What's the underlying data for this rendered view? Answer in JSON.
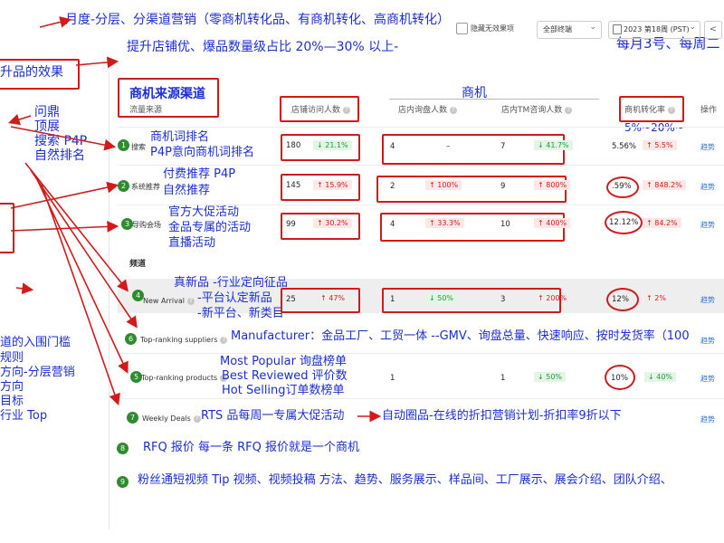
{
  "notes": {
    "top1": "月度-分层、分渠道营销（零商机转化品、有商机转化、高商机转化）",
    "top2": "提升店铺优、爆品数量级占比 20%—30% 以上-",
    "top_right": "每月3号、每周二",
    "left_effect": "升品的效果",
    "left_list": [
      "问鼎",
      "顶展",
      "搜索 P4P",
      "自然排名"
    ],
    "search_note": [
      "商机词排名",
      "P4P意向商机词排名"
    ],
    "p4p_note": [
      "付费推荐 P4P",
      "自然推荐"
    ],
    "event_note": [
      "官方大促活动",
      "金品专属的活动",
      "直播活动"
    ],
    "new_note": [
      "真新品  -行业定向征品",
      "-平台认定新品",
      "-新平台、新类目"
    ],
    "left_bottom": [
      "道的入围门槛",
      "规则",
      "方向-分层营销",
      "方向",
      "目标",
      "行业 Top"
    ],
    "manufacturer": "Manufacturer：金品工厂、工贸一体   --GMV、询盘总量、快速响应、按时发货率（100",
    "products_note": [
      "Most Popular 询盘榜单",
      "Best Reviewed 评价数",
      "Hot Selling订单数榜单"
    ],
    "rts_note": "RTS 品每周一专属大促活动",
    "auto_note": "自动圈品-在线的折扣营销计划-折扣率9折以下",
    "rate_note": "5%~20%~",
    "rfq": "RFQ 报价    每一条 RFQ 报价就是一个商机",
    "fans": "粉丝通短视频 Tip 视频、视频投稿   方法、趋势、服务展示、样品间、工厂展示、展会介绍、团队介绍、"
  },
  "numbers": {
    "n1": "1",
    "n2": "2",
    "n3": "3",
    "n4": "4",
    "n5": "5",
    "n6": "6",
    "n7": "7",
    "n8": "8",
    "n9": "9"
  },
  "toolbar": {
    "hide_label": "隐藏无效果项",
    "terminal": "全部终端",
    "period": "2023 第18周 (PST)",
    "prev": "<"
  },
  "header": {
    "section_title": "商机来源渠道",
    "source_col": "流量来源",
    "biz_title": "商机",
    "col_visitors": "店铺访问人数",
    "col_inquiry": "店内询盘人数",
    "col_tm": "店内TM咨询人数",
    "col_rate": "商机转化率",
    "col_op": "操作"
  },
  "channel_label": "频道",
  "rows": [
    {
      "name": "搜索",
      "visitors": "180",
      "v_chg": "↓ 21.1%",
      "inq": "4",
      "inq_chg": "–",
      "tm": "7",
      "tm_chg": "↓ 41.7%",
      "rate": "5.56%",
      "rate_chg": "↑ 5.5%",
      "op": "趋势"
    },
    {
      "name": "系统推荐",
      "visitors": "145",
      "v_chg": "↑ 15.9%",
      "inq": "2",
      "inq_chg": "↑ 100%",
      "tm": "9",
      "tm_chg": "↑ 800%",
      "rate": ".59%",
      "rate_chg": "↑ 848.2%",
      "op": "趋势"
    },
    {
      "name": "导购会场",
      "visitors": "99",
      "v_chg": "↑ 30.2%",
      "inq": "4",
      "inq_chg": "↑ 33.3%",
      "tm": "10",
      "tm_chg": "↑ 400%",
      "rate": "12.12%",
      "rate_chg": "↑ 84.2%",
      "op": "趋势"
    },
    {
      "name": "New Arrival",
      "visitors": "25",
      "v_chg": "↑ 47%",
      "inq": "1",
      "inq_chg": "↓ 50%",
      "tm": "3",
      "tm_chg": "↑ 200%",
      "rate": "12%",
      "rate_chg": "↑ 2%",
      "op": "趋势"
    },
    {
      "name": "Top-ranking suppliers",
      "op": "趋势"
    },
    {
      "name": "Top-ranking products",
      "visitors": "",
      "v_chg": "",
      "inq": "1",
      "inq_chg": "",
      "tm": "1",
      "tm_chg": "↓ 50%",
      "rate": "10%",
      "rate_chg": "↓ 40%",
      "op": "趋势"
    },
    {
      "name": "Weekly Deals",
      "op": "趋势"
    }
  ]
}
